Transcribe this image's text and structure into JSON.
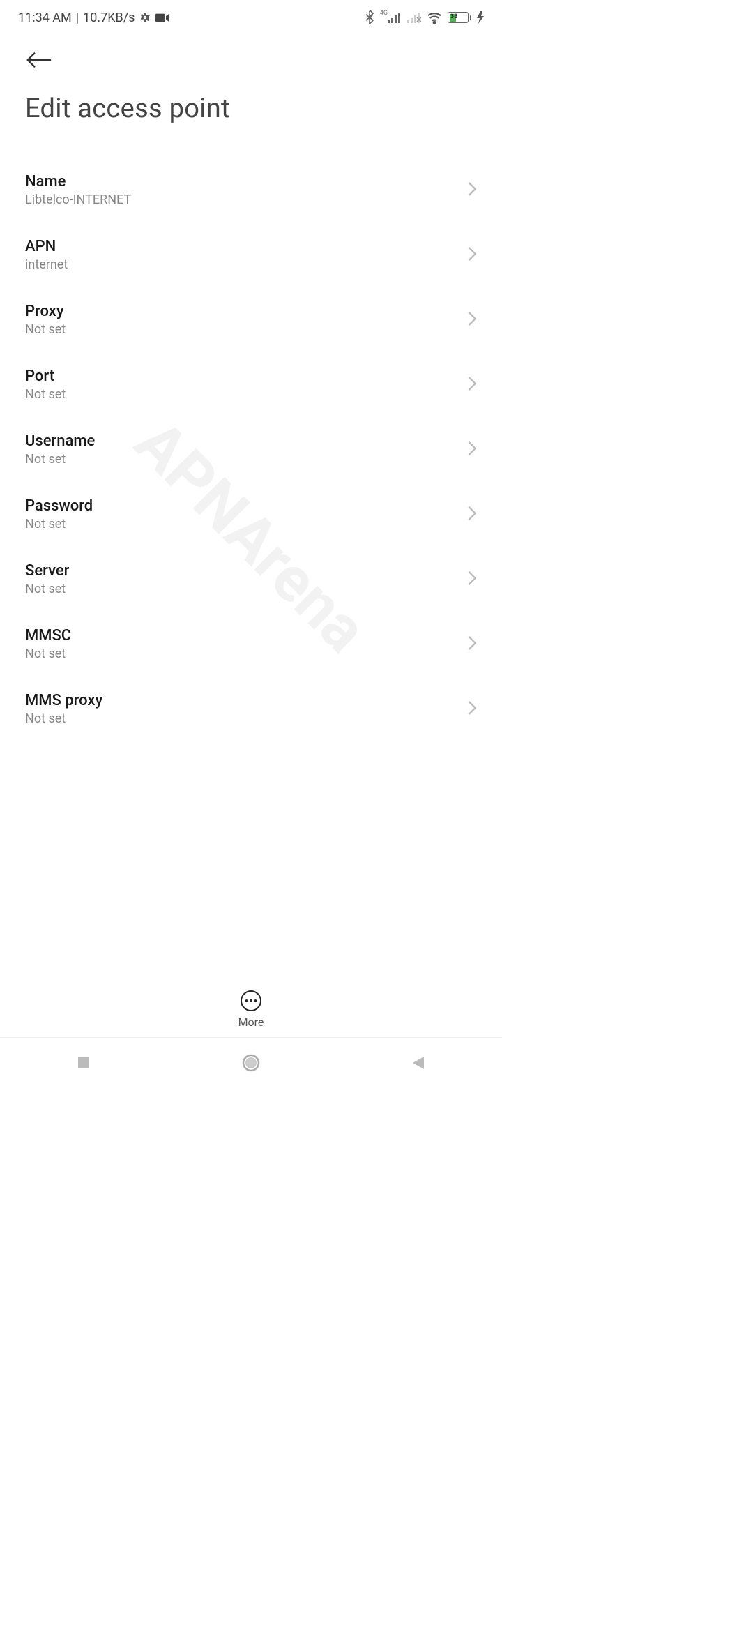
{
  "status": {
    "time": "11:34 AM",
    "speed": "10.7KB/s",
    "battery": "38"
  },
  "header": {
    "title": "Edit access point"
  },
  "settings": [
    {
      "label": "Name",
      "value": "Libtelco-INTERNET"
    },
    {
      "label": "APN",
      "value": "internet"
    },
    {
      "label": "Proxy",
      "value": "Not set"
    },
    {
      "label": "Port",
      "value": "Not set"
    },
    {
      "label": "Username",
      "value": "Not set"
    },
    {
      "label": "Password",
      "value": "Not set"
    },
    {
      "label": "Server",
      "value": "Not set"
    },
    {
      "label": "MMSC",
      "value": "Not set"
    },
    {
      "label": "MMS proxy",
      "value": "Not set"
    }
  ],
  "fab": {
    "label": "More"
  },
  "watermark": "APNArena"
}
